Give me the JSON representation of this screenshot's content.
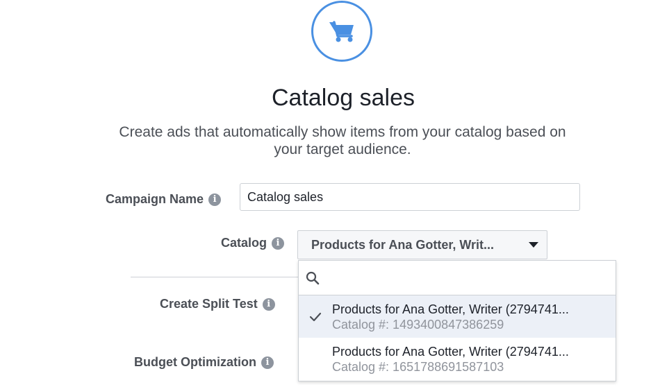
{
  "header": {
    "icon": "shopping-cart-icon",
    "title": "Catalog sales",
    "subtitle_line1": "Create ads that automatically show items from your catalog based on",
    "subtitle_line2": "your target audience."
  },
  "form": {
    "campaign_name": {
      "label": "Campaign Name",
      "value": "Catalog sales"
    },
    "catalog": {
      "label": "Catalog",
      "selected": "Products for Ana Gotter, Writ..."
    },
    "split_test": {
      "label": "Create Split Test"
    },
    "budget": {
      "label": "Budget Optimization"
    }
  },
  "dropdown": {
    "search_placeholder": "",
    "items": [
      {
        "name": "Products for Ana Gotter, Writer (2794741...",
        "sub": "Catalog #: 1493400847386259",
        "selected": true
      },
      {
        "name": "Products for Ana Gotter, Writer (2794741...",
        "sub": "Catalog #: 1651788691587103",
        "selected": false
      }
    ]
  },
  "colors": {
    "accent": "#4a90e2",
    "selected_bg": "#ecf0f7"
  }
}
